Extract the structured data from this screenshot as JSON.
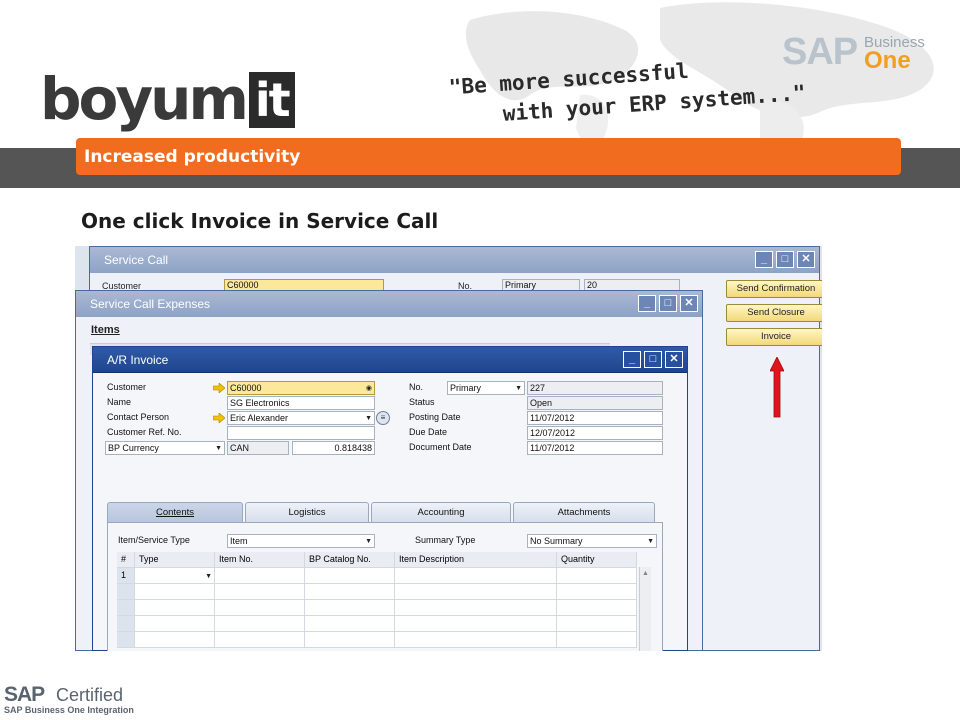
{
  "header": {
    "logo": {
      "text": "boyum",
      "box_text": "it"
    },
    "tagline": {
      "line1": "\"Be more successful",
      "line2": "with your ERP system...\""
    },
    "sap_logo": {
      "word": "SAP",
      "business": "Business",
      "one": "One"
    },
    "section_label": "Increased productivity"
  },
  "page_title": "One click Invoice in Service Call",
  "service_call": {
    "title": "Service Call",
    "customer_label": "Customer",
    "customer_value": "C60000",
    "no_label": "No.",
    "series": "Primary",
    "number": "20",
    "buttons": {
      "send_confirmation": "Send Confirmation",
      "send_closure": "Send Closure",
      "invoice": "Invoice"
    }
  },
  "service_call_expenses": {
    "title": "Service Call Expenses",
    "items_label": "Items"
  },
  "ar_invoice": {
    "title": "A/R Invoice",
    "left_fields": {
      "customer_label": "Customer",
      "customer_value": "C60000",
      "name_label": "Name",
      "name_value": "SG Electronics",
      "contact_label": "Contact Person",
      "contact_value": "Eric Alexander",
      "ref_label": "Customer Ref. No.",
      "ref_value": "",
      "currency_label": "BP Currency",
      "currency_value": "CAN",
      "rate_value": "0.818438"
    },
    "right_fields": {
      "no_label": "No.",
      "series": "Primary",
      "number": "227",
      "status_label": "Status",
      "status_value": "Open",
      "posting_label": "Posting Date",
      "posting_value": "11/07/2012",
      "due_label": "Due Date",
      "due_value": "12/07/2012",
      "document_label": "Document Date",
      "document_value": "11/07/2012"
    },
    "tabs": [
      "Contents",
      "Logistics",
      "Accounting",
      "Attachments"
    ],
    "item_type_label": "Item/Service Type",
    "item_type_value": "Item",
    "summary_label": "Summary Type",
    "summary_value": "No Summary",
    "columns": [
      "#",
      "Type",
      "Item No.",
      "BP Catalog No.",
      "Item Description",
      "Quantity"
    ],
    "first_row_no": "1"
  },
  "footer": {
    "sap": "SAP",
    "certified": "Certified",
    "integration": "SAP Business One Integration"
  },
  "colors": {
    "orange_bar": "#f26c1f",
    "dark_band": "#555555",
    "title_active": "#1f4590",
    "title_inactive": "#8da2c5",
    "highlight_yellow": "#fbe89a",
    "arrow_red": "#e0141c"
  }
}
